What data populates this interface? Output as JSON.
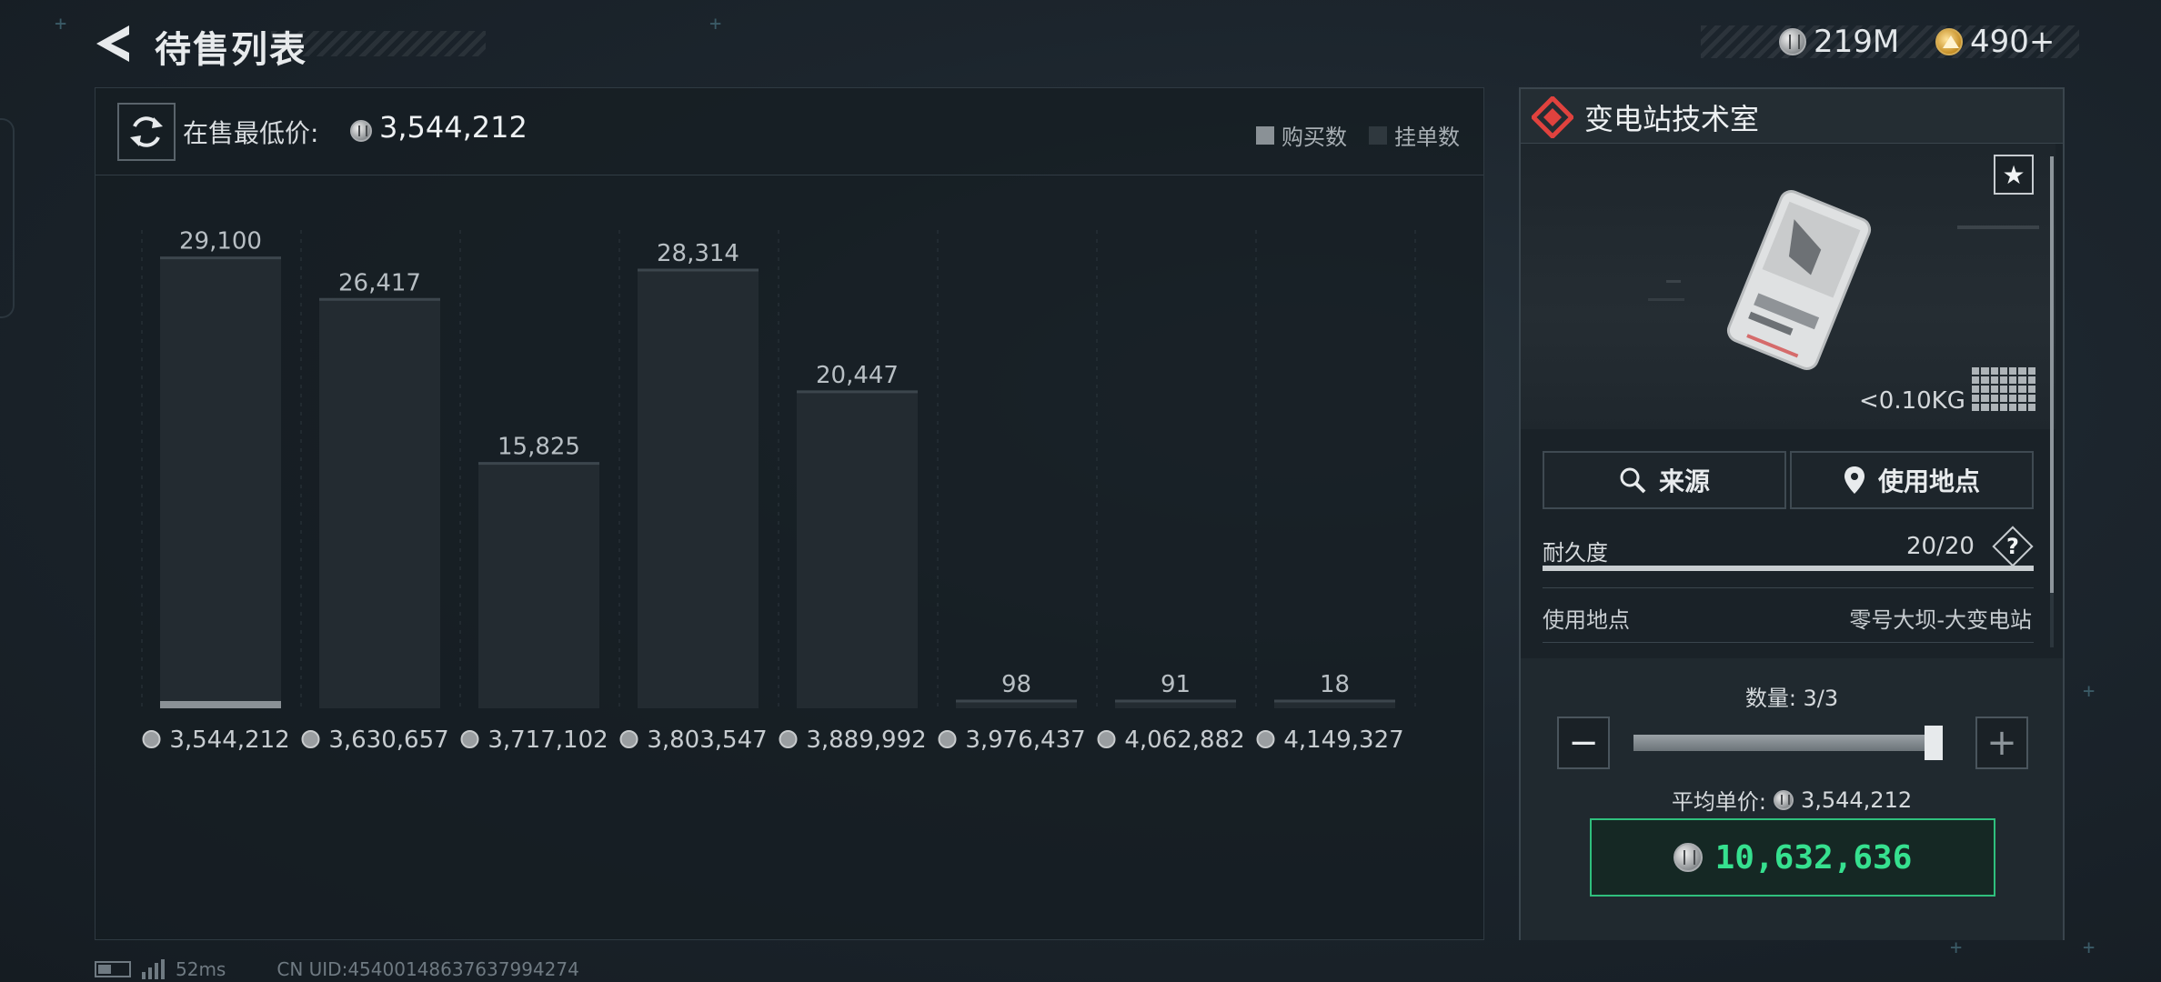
{
  "header": {
    "title": "待售列表",
    "currency_silver": "219M",
    "currency_gold": "490+"
  },
  "chart_header": {
    "lowest_price_label": "在售最低价:",
    "lowest_price_value": "3,544,212",
    "legend_buy": "购买数",
    "legend_list": "挂单数"
  },
  "chart_data": {
    "type": "bar",
    "categories": [
      "3,544,212",
      "3,630,657",
      "3,717,102",
      "3,803,547",
      "3,889,992",
      "3,976,437",
      "4,062,882",
      "4,149,327"
    ],
    "series": [
      {
        "name": "挂单数",
        "values": [
          29100,
          26417,
          15825,
          28314,
          20447,
          98,
          91,
          18
        ]
      },
      {
        "name": "购买数",
        "values": [
          3,
          0,
          0,
          0,
          0,
          0,
          0,
          0
        ]
      }
    ],
    "value_labels": [
      "29,100",
      "26,417",
      "15,825",
      "28,314",
      "20,447",
      "98",
      "91",
      "18"
    ],
    "ylim": [
      0,
      30000
    ],
    "colors": {
      "listing": "#232b31",
      "buy": "#8a9196",
      "grid": "#2c363d"
    }
  },
  "status": {
    "ping": "52ms",
    "uid": "CN UID:454001486376379942​74"
  },
  "item": {
    "name": "变电站技术室",
    "weight": "<0.10KG",
    "source_label": "来源",
    "use_location_btn": "使用地点",
    "durability_label": "耐久度",
    "durability_value": "20/20",
    "durability_fraction": 1.0,
    "help_label": "?",
    "location_label": "使用地点",
    "location_value": "零号大坝-大变电站",
    "quantity_label": "数量: 3/3",
    "quantity_fraction": 1.0,
    "avg_label": "平均单价:",
    "avg_value": "3,544,212",
    "total_value": "10,632,636"
  }
}
